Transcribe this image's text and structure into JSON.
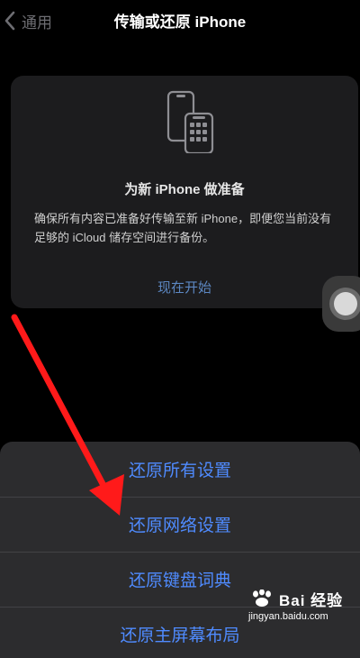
{
  "nav": {
    "back_label": "通用",
    "title": "传输或还原 iPhone"
  },
  "card": {
    "icon": "two-iphones-icon",
    "title": "为新 iPhone 做准备",
    "description": "确保所有内容已准备好传输至新 iPhone，即便您当前没有足够的 iCloud 储存空间进行备份。",
    "link": "现在开始"
  },
  "sheet": {
    "items": [
      {
        "label": "还原所有设置"
      },
      {
        "label": "还原网络设置"
      },
      {
        "label": "还原键盘词典"
      },
      {
        "label": "还原主屏幕布局"
      }
    ]
  },
  "watermark": {
    "brand": "Bai 经验",
    "url": "jingyan.baidu.com"
  },
  "colors": {
    "accent": "#4f8bff",
    "link": "#5c87c2",
    "arrow": "#ff1a1a",
    "background": "#000000",
    "card": "#1c1c1e",
    "sheet": "#2c2c2e"
  }
}
